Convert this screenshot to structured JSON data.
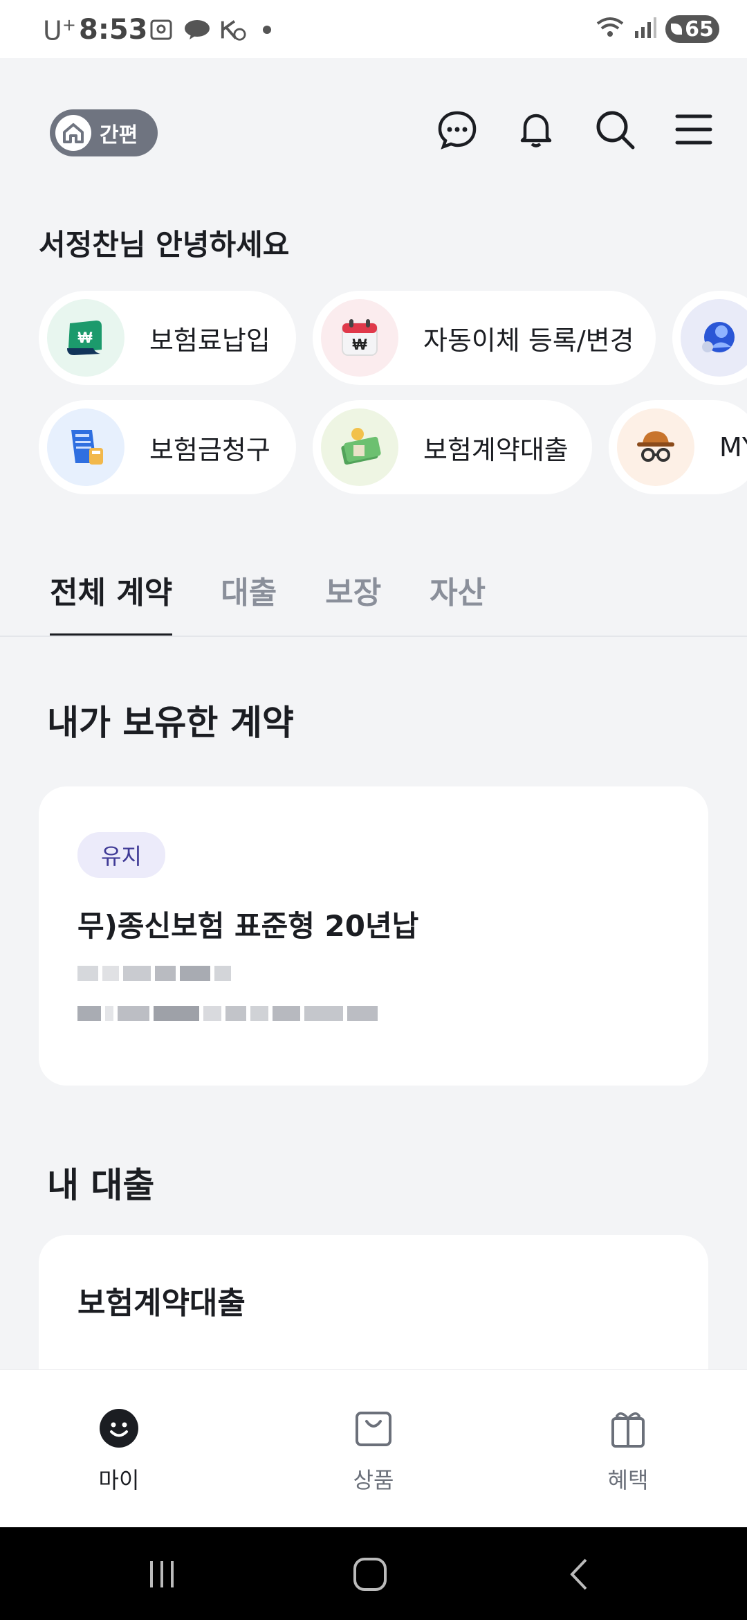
{
  "status_bar": {
    "carrier": "U",
    "carrier_sup": "+",
    "time": "8:53",
    "battery": "65",
    "notification_icons": [
      "gallery-icon",
      "talk-icon",
      "k-icon"
    ],
    "system_icons": [
      "wifi-icon",
      "signal-icon",
      "battery-icon"
    ]
  },
  "header": {
    "simple_mode_label": "간편",
    "icons": [
      "chat-icon",
      "bell-icon",
      "search-icon",
      "menu-icon"
    ]
  },
  "greeting": "서정찬님 안녕하세요",
  "quick_menu": {
    "row1": [
      {
        "label": "보험료납입",
        "icon": "money-note-icon",
        "bg": "#e8f6ef"
      },
      {
        "label": "자동이체 등록/변경",
        "icon": "calendar-won-icon",
        "bg": "#fbecee"
      },
      {
        "label": "",
        "icon": "advisor-icon",
        "bg": "#e9ebf8"
      }
    ],
    "row2": [
      {
        "label": "보험금청구",
        "icon": "claim-document-icon",
        "bg": "#e7f0fd"
      },
      {
        "label": "보험계약대출",
        "icon": "cash-coin-icon",
        "bg": "#eef5e3"
      },
      {
        "label": "MY",
        "icon": "detective-icon",
        "bg": "#fdf0e6"
      }
    ]
  },
  "tabs": [
    "전체 계약",
    "대출",
    "보장",
    "자산"
  ],
  "sections": {
    "contracts_title": "내가 보유한 계약",
    "contract_card": {
      "status": "유지",
      "name": "무)종신보험 표준형 20년납"
    },
    "loans_title": "내 대출",
    "loan_card": {
      "title": "보험계약대출"
    }
  },
  "bottom_nav": [
    {
      "label": "마이",
      "icon": "smile-icon",
      "active": true
    },
    {
      "label": "상품",
      "icon": "shopping-bag-icon",
      "active": false
    },
    {
      "label": "혜택",
      "icon": "gift-icon",
      "active": false
    }
  ],
  "colors": {
    "accent_dark": "#1b1d22",
    "toggle_bg": "#6f7480",
    "page_bg": "#f3f4f6",
    "badge_bg": "#ecebfa",
    "badge_text": "#3f3a96"
  }
}
